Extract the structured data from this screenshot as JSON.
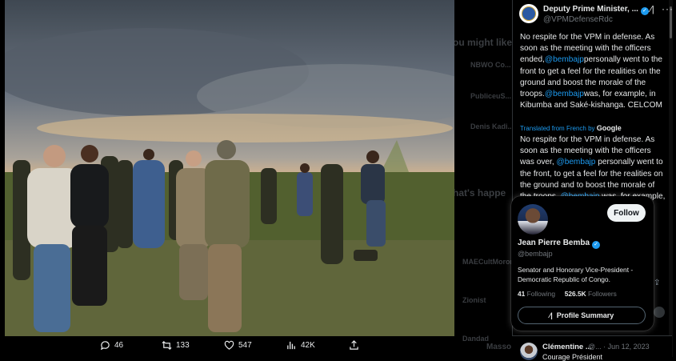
{
  "viewer": {
    "actions": {
      "replies": "46",
      "reposts": "133",
      "likes": "547",
      "views": "42K"
    }
  },
  "background_sidebar": {
    "items": [
      "ou might like",
      "NBWO Co...",
      "PubliceuS...",
      "Denis Kadi...",
      "hat's happe",
      "MAECultMoron",
      "Zionist",
      "Dandad",
      "Masso"
    ]
  },
  "tweet": {
    "author_name": "Deputy Prime Minister, ...",
    "author_handle": "@VPMDefenseRdc",
    "text_before_mention_1": "No respite for the VPM in defense. As soon as the meeting with the officers ended,",
    "mention_1": "@bembajp",
    "text_after_mention_1": "personally went to the front to get a feel for the realities on the ground and boost the morale of the troops.",
    "mention_2": "@bembajp",
    "text_after_mention_2": "was, for example, in Kibumba and Saké-kishanga. CELCOM",
    "translated_label": "Translated from French by",
    "translator": "Google",
    "translation_before_mention_1": "No respite for the VPM in defense. As soon as the meeting with the officers was over,",
    "translation_mention_1": "@bembajp",
    "translation_after_mention_1": "personally went to the front, to get a feel for the realities on the ground and to boost the morale of the troops.",
    "translation_mention_2": "@bembajp",
    "translation_after_mention_2": "was, for example, in Kibumba and"
  },
  "hover_card": {
    "name": "Jean Pierre Bemba",
    "handle": "@bembajp",
    "follow_label": "Follow",
    "bio": "Senator and Honorary Vice-President - Democratic Republic of Congo.",
    "following_count": "41",
    "following_label": "Following",
    "followers_count": "526.5K",
    "followers_label": "Followers",
    "profile_summary_label": "Profile Summary"
  },
  "reply": {
    "name": "Clémentine ...",
    "meta": "@... · Jun 12, 2023",
    "text": "Courage Président"
  },
  "colors": {
    "accent": "#1d9bf0",
    "background": "#000000",
    "text": "#e7e9ea",
    "muted": "#71767b"
  },
  "icons": [
    "expand-icon",
    "next-arrow-icon",
    "reply-icon",
    "repost-icon",
    "like-icon",
    "views-icon",
    "share-icon",
    "verified-icon",
    "grok-icon",
    "more-icon"
  ]
}
